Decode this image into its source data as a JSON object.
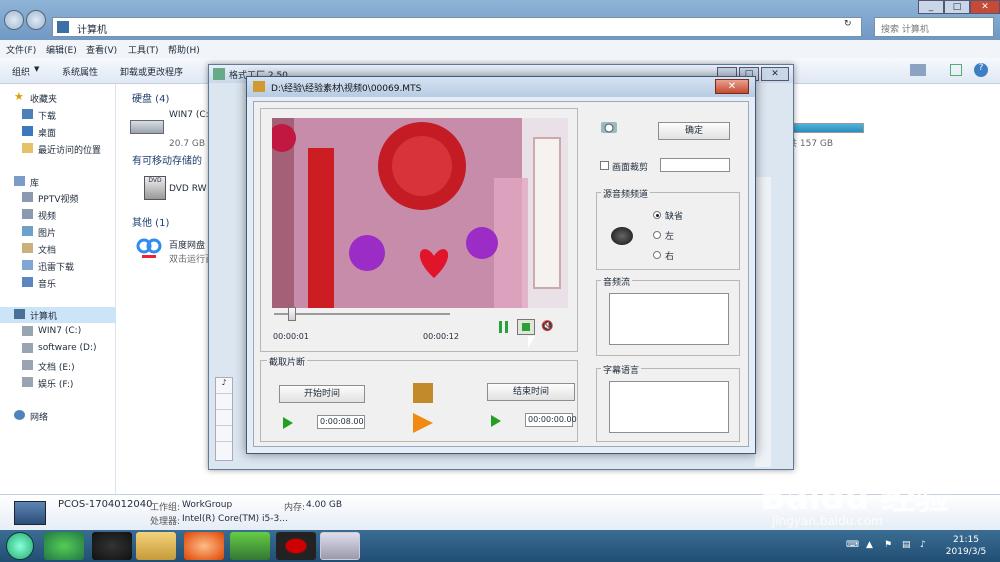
{
  "explorer": {
    "address": "计算机",
    "search_placeholder": "搜索 计算机",
    "menu": [
      "文件(F)",
      "编辑(E)",
      "查看(V)",
      "工具(T)",
      "帮助(H)"
    ],
    "toolbar": [
      "组织",
      "系统属性",
      "卸载或更改程序"
    ],
    "nav": {
      "favorites_label": "收藏夹",
      "favorites": [
        "下载",
        "桌面",
        "最近访问的位置"
      ],
      "library_label": "库",
      "libraries": [
        "PPTV视频",
        "视频",
        "图片",
        "文档",
        "迅雷下载",
        "音乐"
      ],
      "computer_label": "计算机",
      "drives": [
        "WIN7 (C:)",
        "software (D:)",
        "文档 (E:)",
        "娱乐 (F:)"
      ],
      "network_label": "网络"
    },
    "content": {
      "hdd_section": "硬盘 (4)",
      "drive_c_name": "WIN7 (C:)",
      "drive_c_size": "20.7 GB 可",
      "drive_right_size": "共 157 GB",
      "removable_section": "有可移动存储的",
      "dvd_name": "DVD RW",
      "other_section": "其他 (1)",
      "baidu_name": "百度网盘",
      "baidu_desc": "双击运行百"
    },
    "details": {
      "pc_name": "PCOS-1704012040",
      "workgroup_label": "工作组:",
      "workgroup": "WorkGroup",
      "memory_label": "内存:",
      "memory": "4.00 GB",
      "cpu_label": "处理器:",
      "cpu": "Intel(R) Core(TM) i5-3..."
    }
  },
  "formatfactory": {
    "title": "格式工厂 2.50"
  },
  "dialog": {
    "title": "D:\\经验\\经验素材\\视频0\\00069.MTS",
    "ok_label": "确定",
    "crop_label": "画面裁剪",
    "audio_channel_legend": "源音频频道",
    "channel_options": [
      "缺省",
      "左",
      "右"
    ],
    "channel_selected": 0,
    "audio_stream_legend": "音频流",
    "subtitle_legend": "字幕语言",
    "time_current": "00:00:01",
    "time_total": "00:00:12",
    "clip_legend": "截取片断",
    "start_button": "开始时间",
    "end_button": "结束时间",
    "start_time": "0:00:08.00",
    "end_time": "00:00:00.00",
    "seek_fraction": 0.08
  },
  "taskbar": {
    "time": "21:15",
    "date": "2019/3/5"
  },
  "watermark": {
    "main": "Baidu 经验",
    "sub": "jingyan.baidu.com"
  }
}
